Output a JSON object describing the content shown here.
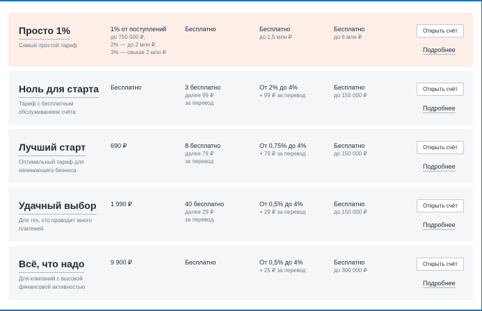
{
  "colors": {
    "highlight_bg": "#fdeee8",
    "card_bg": "#f4f6f8",
    "accent_line": "#1f6fb4"
  },
  "tariffs": [
    {
      "name": "Просто 1%",
      "desc": "Самый простой тариф",
      "c1_main": "1% от поступлений",
      "c1_sub": [
        "до 750 000 ₽,",
        "2% — до 2 млн ₽,",
        "3% — свыше 2 млн ₽"
      ],
      "c2_main": "Бесплатно",
      "c2_sub": [],
      "c3_main": "Бесплатно",
      "c3_sub": [
        "до 1,5 млн ₽"
      ],
      "c4_main": "Бесплатно",
      "c4_sub": [
        "до 6 млн ₽"
      ],
      "button": "Открыть счёт",
      "more": "Подробнее"
    },
    {
      "name": "Ноль для старта",
      "desc": "Тариф с бесплатным обслуживанием счёта",
      "c1_main": "Бесплатно",
      "c1_sub": [],
      "c2_main": "3 бесплатно",
      "c2_sub": [
        "далее 99 ₽",
        "за перевод"
      ],
      "c3_main": "От 2% до 4%",
      "c3_sub": [
        "+ 99 ₽ за перевод"
      ],
      "c4_main": "Бесплатно",
      "c4_sub": [
        "до 150 000 ₽"
      ],
      "button": "Открыть счёт",
      "more": "Подробнее"
    },
    {
      "name": "Лучший старт",
      "desc": "Оптимальный тариф для начинающего бизнеса",
      "c1_main": "690 ₽",
      "c1_sub": [],
      "c2_main": "8 бесплатно",
      "c2_sub": [
        "далее 79 ₽",
        "за перевод"
      ],
      "c3_main": "От 0,75% до 4%",
      "c3_sub": [
        "+ 79 ₽ за перевод"
      ],
      "c4_main": "Бесплатно",
      "c4_sub": [
        "до 150 000 ₽"
      ],
      "button": "Открыть счёт",
      "more": "Подробнее"
    },
    {
      "name": "Удачный выбор",
      "desc": "Для тех, кто проводит много платежей",
      "c1_main": "1 990 ₽",
      "c1_sub": [],
      "c2_main": "40 бесплатно",
      "c2_sub": [
        "далее 29 ₽",
        "за перевод"
      ],
      "c3_main": "От 0,5% до 4%",
      "c3_sub": [
        "+ 29 ₽ за перевод"
      ],
      "c4_main": "Бесплатно",
      "c4_sub": [
        "до 150 000 ₽"
      ],
      "button": "Открыть счёт",
      "more": "Подробнее"
    },
    {
      "name": "Всё, что надо",
      "desc": "Для компаний с высокой финансовой активностью",
      "c1_main": "9 900 ₽",
      "c1_sub": [],
      "c2_main": "Бесплатно",
      "c2_sub": [],
      "c3_main": "От 0,5% до 4%",
      "c3_sub": [
        "+ 25 ₽ за перевод"
      ],
      "c4_main": "Бесплатно",
      "c4_sub": [
        "до 300 000 ₽"
      ],
      "button": "Открыть счёт",
      "more": "Подробнее"
    }
  ]
}
